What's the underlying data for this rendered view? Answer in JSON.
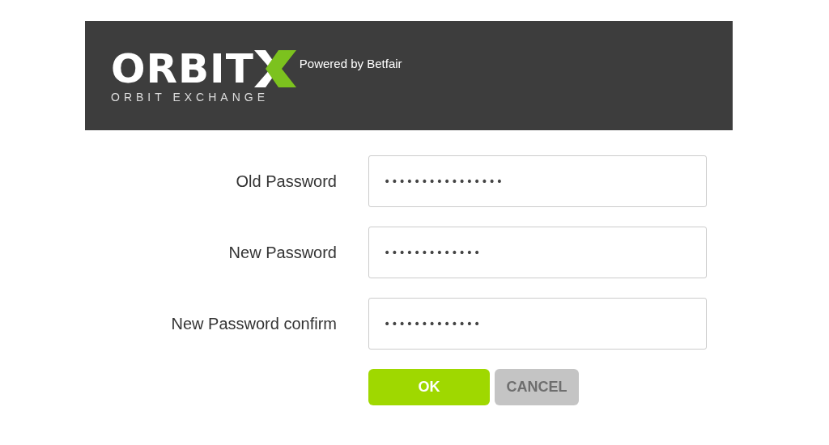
{
  "header": {
    "logo": {
      "wordmark": "ORBIT",
      "tagline": "Powered by Betfair",
      "subtitle": "ORBIT EXCHANGE"
    }
  },
  "fields": [
    {
      "label": "Old Password",
      "value": "••••••••••••••••"
    },
    {
      "label": "New Password",
      "value": "•••••••••••••"
    },
    {
      "label": "New Password confirm",
      "value": "•••••••••••••"
    }
  ],
  "buttons": [
    {
      "label": "OK",
      "kind": "primary",
      "disabled": false
    },
    {
      "label": "CANCEL",
      "kind": "secondary",
      "disabled": true
    }
  ]
}
